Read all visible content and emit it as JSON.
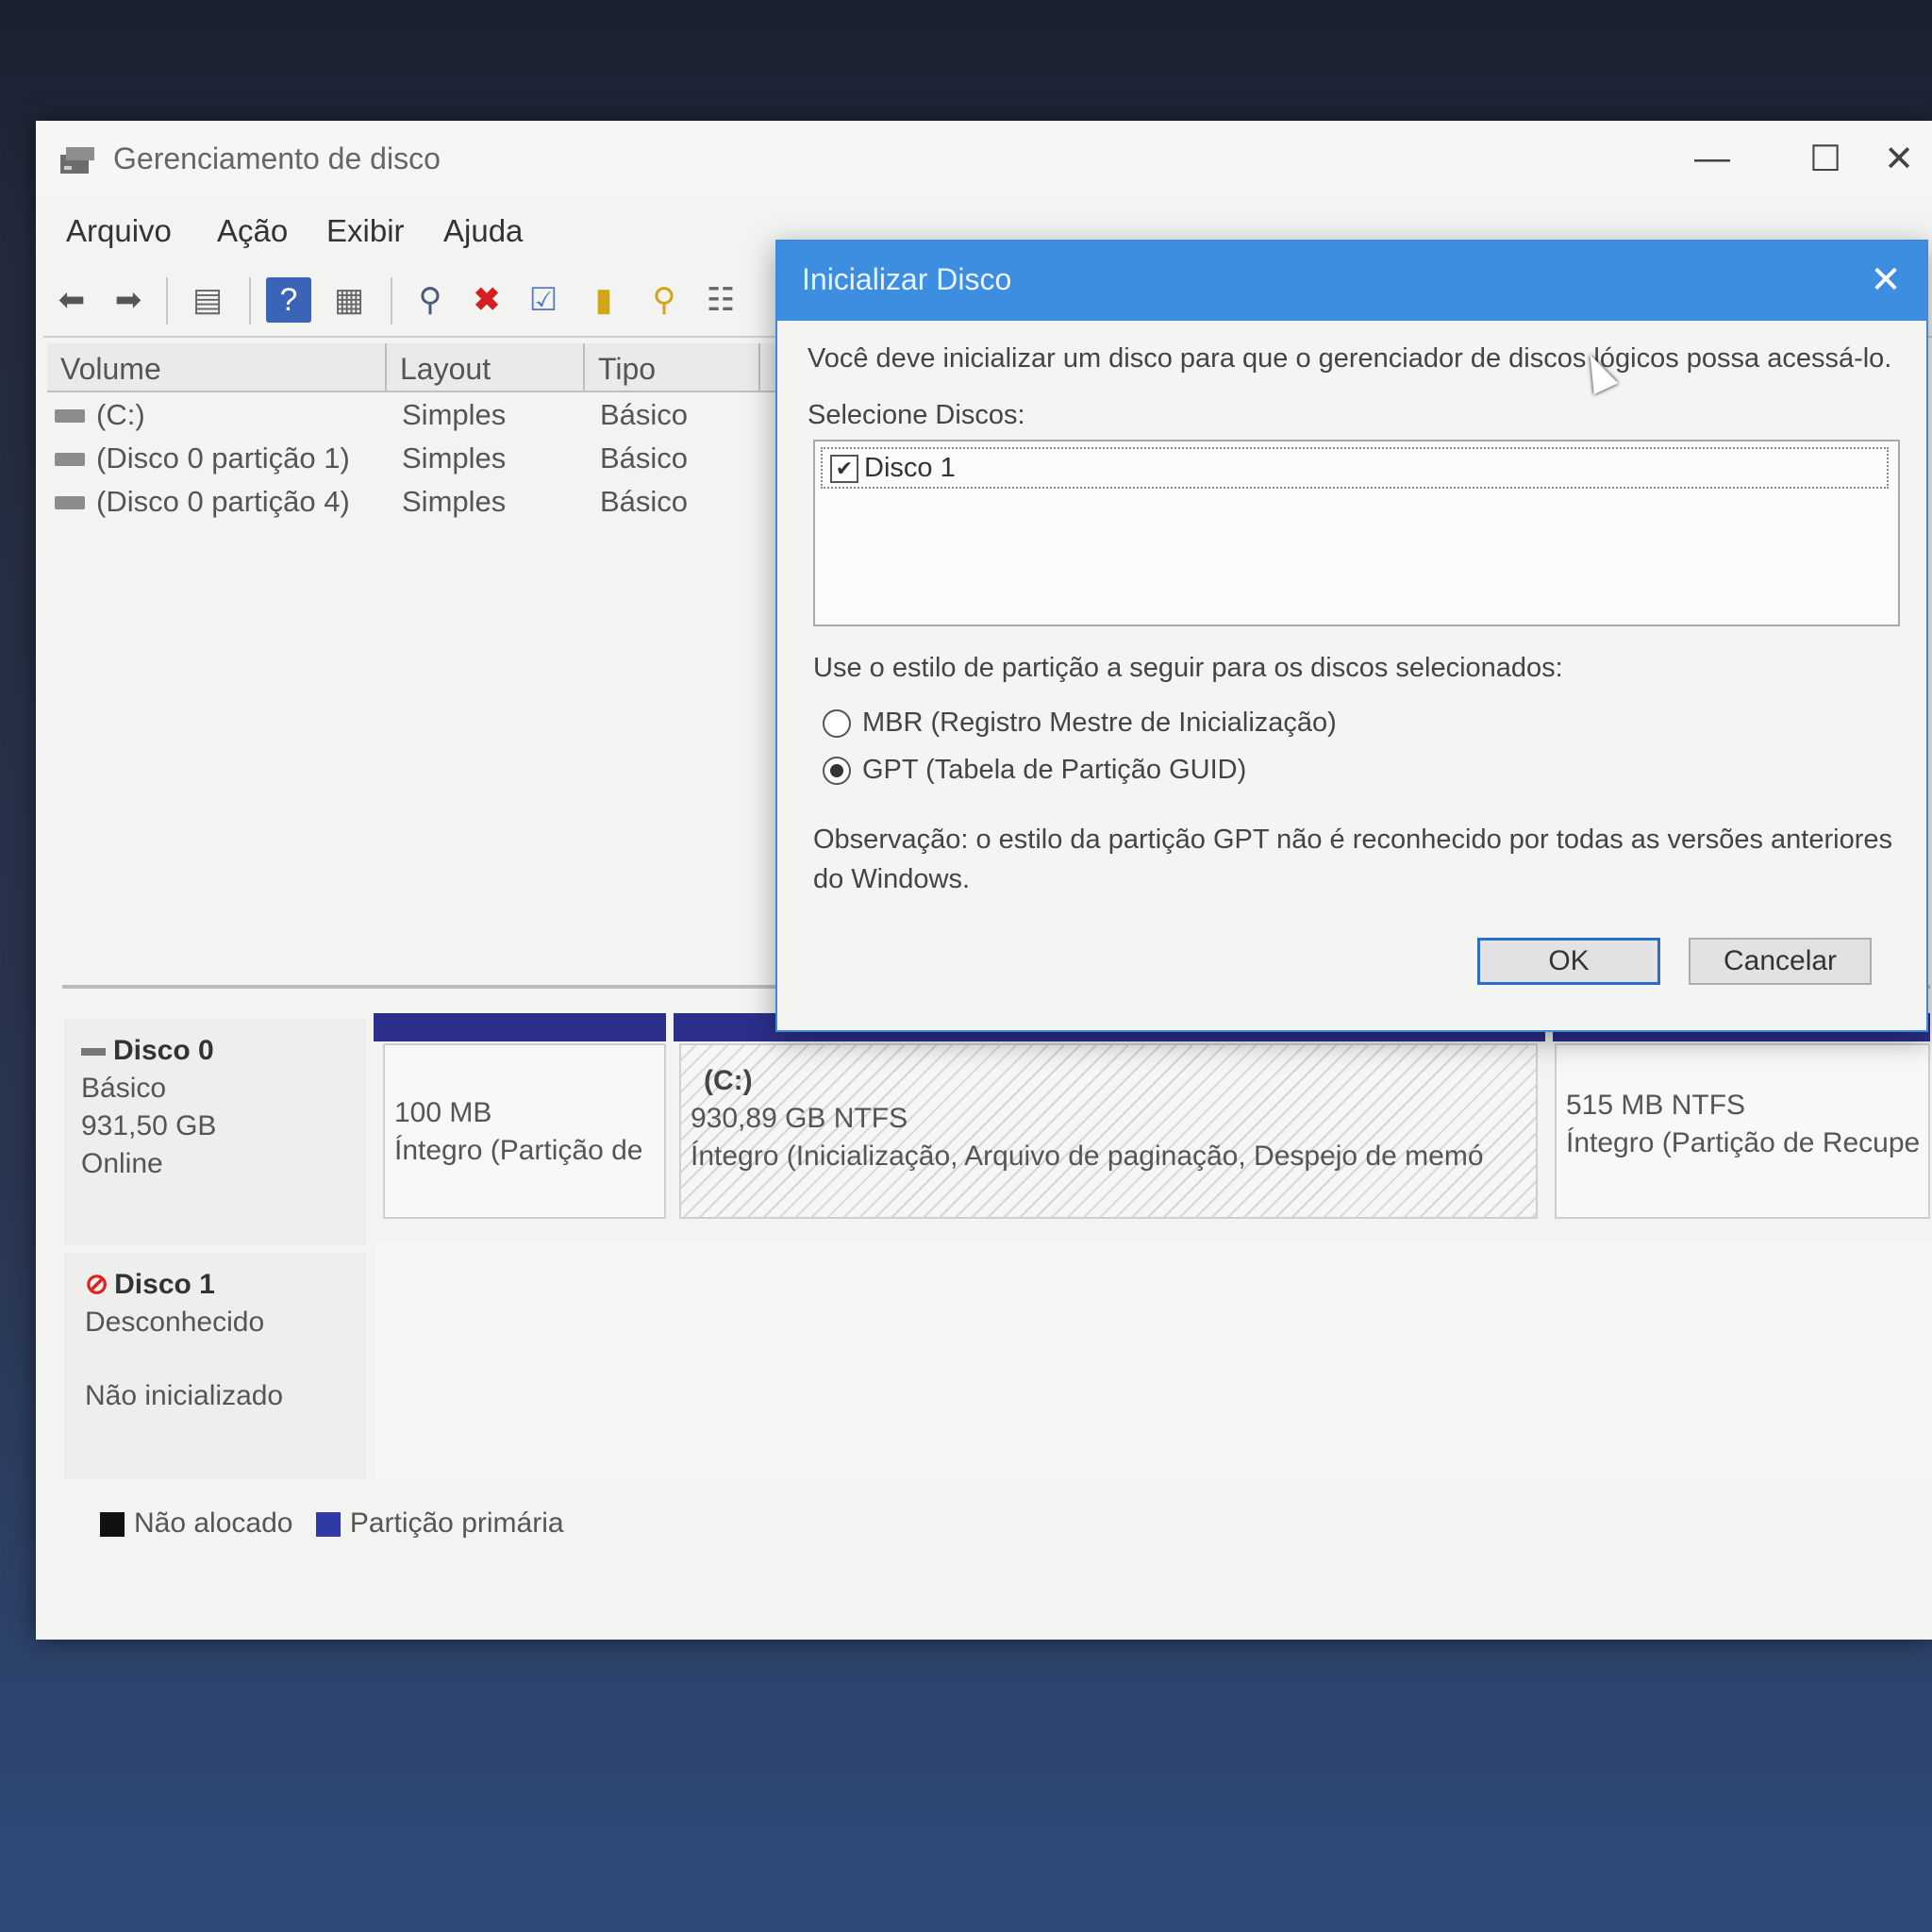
{
  "window": {
    "title": "Gerenciamento de disco",
    "controls": {
      "minimize": "—",
      "maximize": "☐",
      "close": "✕"
    }
  },
  "menu": [
    "Arquivo",
    "Ação",
    "Exibir",
    "Ajuda"
  ],
  "volume_table": {
    "columns": [
      "Volume",
      "Layout",
      "Tipo"
    ],
    "rows": [
      {
        "volume": "(C:)",
        "layout": "Simples",
        "tipo": "Básico"
      },
      {
        "volume": "(Disco 0 partição 1)",
        "layout": "Simples",
        "tipo": "Básico"
      },
      {
        "volume": "(Disco 0 partição 4)",
        "layout": "Simples",
        "tipo": "Básico"
      }
    ]
  },
  "disk0": {
    "name": "Disco 0",
    "type": "Básico",
    "size": "931,50 GB",
    "status": "Online",
    "partitions": [
      {
        "label": "",
        "size": "100 MB",
        "status": "Íntegro (Partição de"
      },
      {
        "label": "(C:)",
        "size": "930,89 GB NTFS",
        "status": "Íntegro (Inicialização, Arquivo de paginação, Despejo de memó"
      },
      {
        "label": "",
        "size": "515 MB NTFS",
        "status": "Íntegro (Partição de Recupe"
      }
    ]
  },
  "disk1": {
    "name": "Disco 1",
    "type": "Desconhecido",
    "status": "Não inicializado"
  },
  "legend": [
    {
      "label": "Não alocado",
      "color": "#111111"
    },
    {
      "label": "Partição primária",
      "color": "#2f3aa8"
    }
  ],
  "dialog": {
    "title": "Inicializar Disco",
    "intro": "Você deve inicializar um disco para que o gerenciador de discos lógicos possa acessá-lo.",
    "select_label": "Selecione Discos:",
    "disks": [
      {
        "label": "Disco 1",
        "checked": true
      }
    ],
    "style_label": "Use o estilo de partição a seguir para os discos selecionados:",
    "options": [
      {
        "label": "MBR (Registro Mestre de Inicialização)",
        "selected": false
      },
      {
        "label": "GPT (Tabela de Partição GUID)",
        "selected": true
      }
    ],
    "note_line1": "Observação: o estilo da partição GPT não é reconhecido por todas as versões anteriores",
    "note_line2": "do Windows.",
    "ok": "OK",
    "cancel": "Cancelar"
  }
}
